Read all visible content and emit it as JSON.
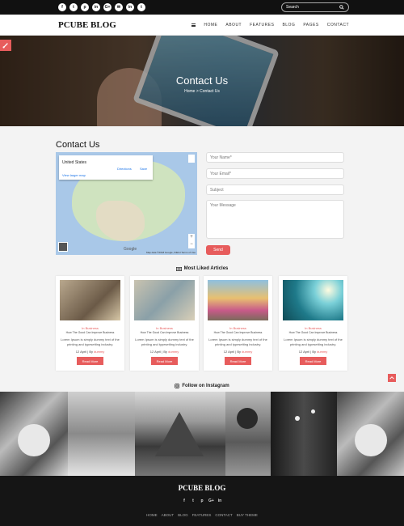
{
  "topbar": {
    "social": [
      "f",
      "t",
      "p",
      "in",
      "G+",
      "✉",
      "in",
      "t"
    ],
    "search_placeholder": "Search"
  },
  "nav": {
    "logo": "PCUBE BLOG",
    "items": [
      "HOME",
      "ABOUT",
      "FEATURES",
      "BLOG",
      "PAGES",
      "CONTACT"
    ]
  },
  "hero": {
    "title": "Contact Us",
    "breadcrumb": "Home > Contact Us"
  },
  "contact": {
    "title": "Contact Us",
    "map": {
      "place": "United States",
      "larger_map": "View larger map",
      "directions": "Directions",
      "save": "Save",
      "google": "Google",
      "attribution": "Map data ©2018 Google, INEGI   Terms of Use"
    },
    "form": {
      "name_placeholder": "Your Name*",
      "email_placeholder": "Your Email*",
      "subject_placeholder": "Subject",
      "message_placeholder": "Your Message",
      "send_label": "Send"
    }
  },
  "articles": {
    "title": "Most Liked Articles",
    "items": [
      {
        "category": "In Business",
        "title": "How The Good Can Improve Business",
        "desc": "Lorem Ipsum is simply dummy text of the printing and typesetting industry.",
        "date": "12 April | By",
        "author": "dummy",
        "button": "Read More"
      },
      {
        "category": "In Business",
        "title": "How The Good Can Improve Business",
        "desc": "Lorem Ipsum is simply dummy text of the printing and typesetting industry.",
        "date": "12 April | By",
        "author": "dummy",
        "button": "Read More"
      },
      {
        "category": "In Business",
        "title": "How The Good Can Improve Business",
        "desc": "Lorem Ipsum is simply dummy text of the printing and typesetting industry.",
        "date": "12 April | By",
        "author": "dummy",
        "button": "Read More"
      },
      {
        "category": "In Business",
        "title": "How The Good Can Improve Business",
        "desc": "Lorem Ipsum is simply dummy text of the printing and typesetting industry.",
        "date": "12 April | By",
        "author": "dummy",
        "button": "Read More"
      }
    ]
  },
  "instagram": {
    "title": "Follow on Instagram"
  },
  "footer": {
    "logo": "PCUBE BLOG",
    "social": [
      "f",
      "t",
      "p",
      "G+",
      "in"
    ],
    "links": [
      "HOME",
      "ABOUT",
      "BLOG",
      "FEATURES",
      "CONTACT",
      "BUY THEME"
    ]
  },
  "colors": {
    "accent": "#e75c5c",
    "topbar": "#111111",
    "footer": "#151515"
  }
}
